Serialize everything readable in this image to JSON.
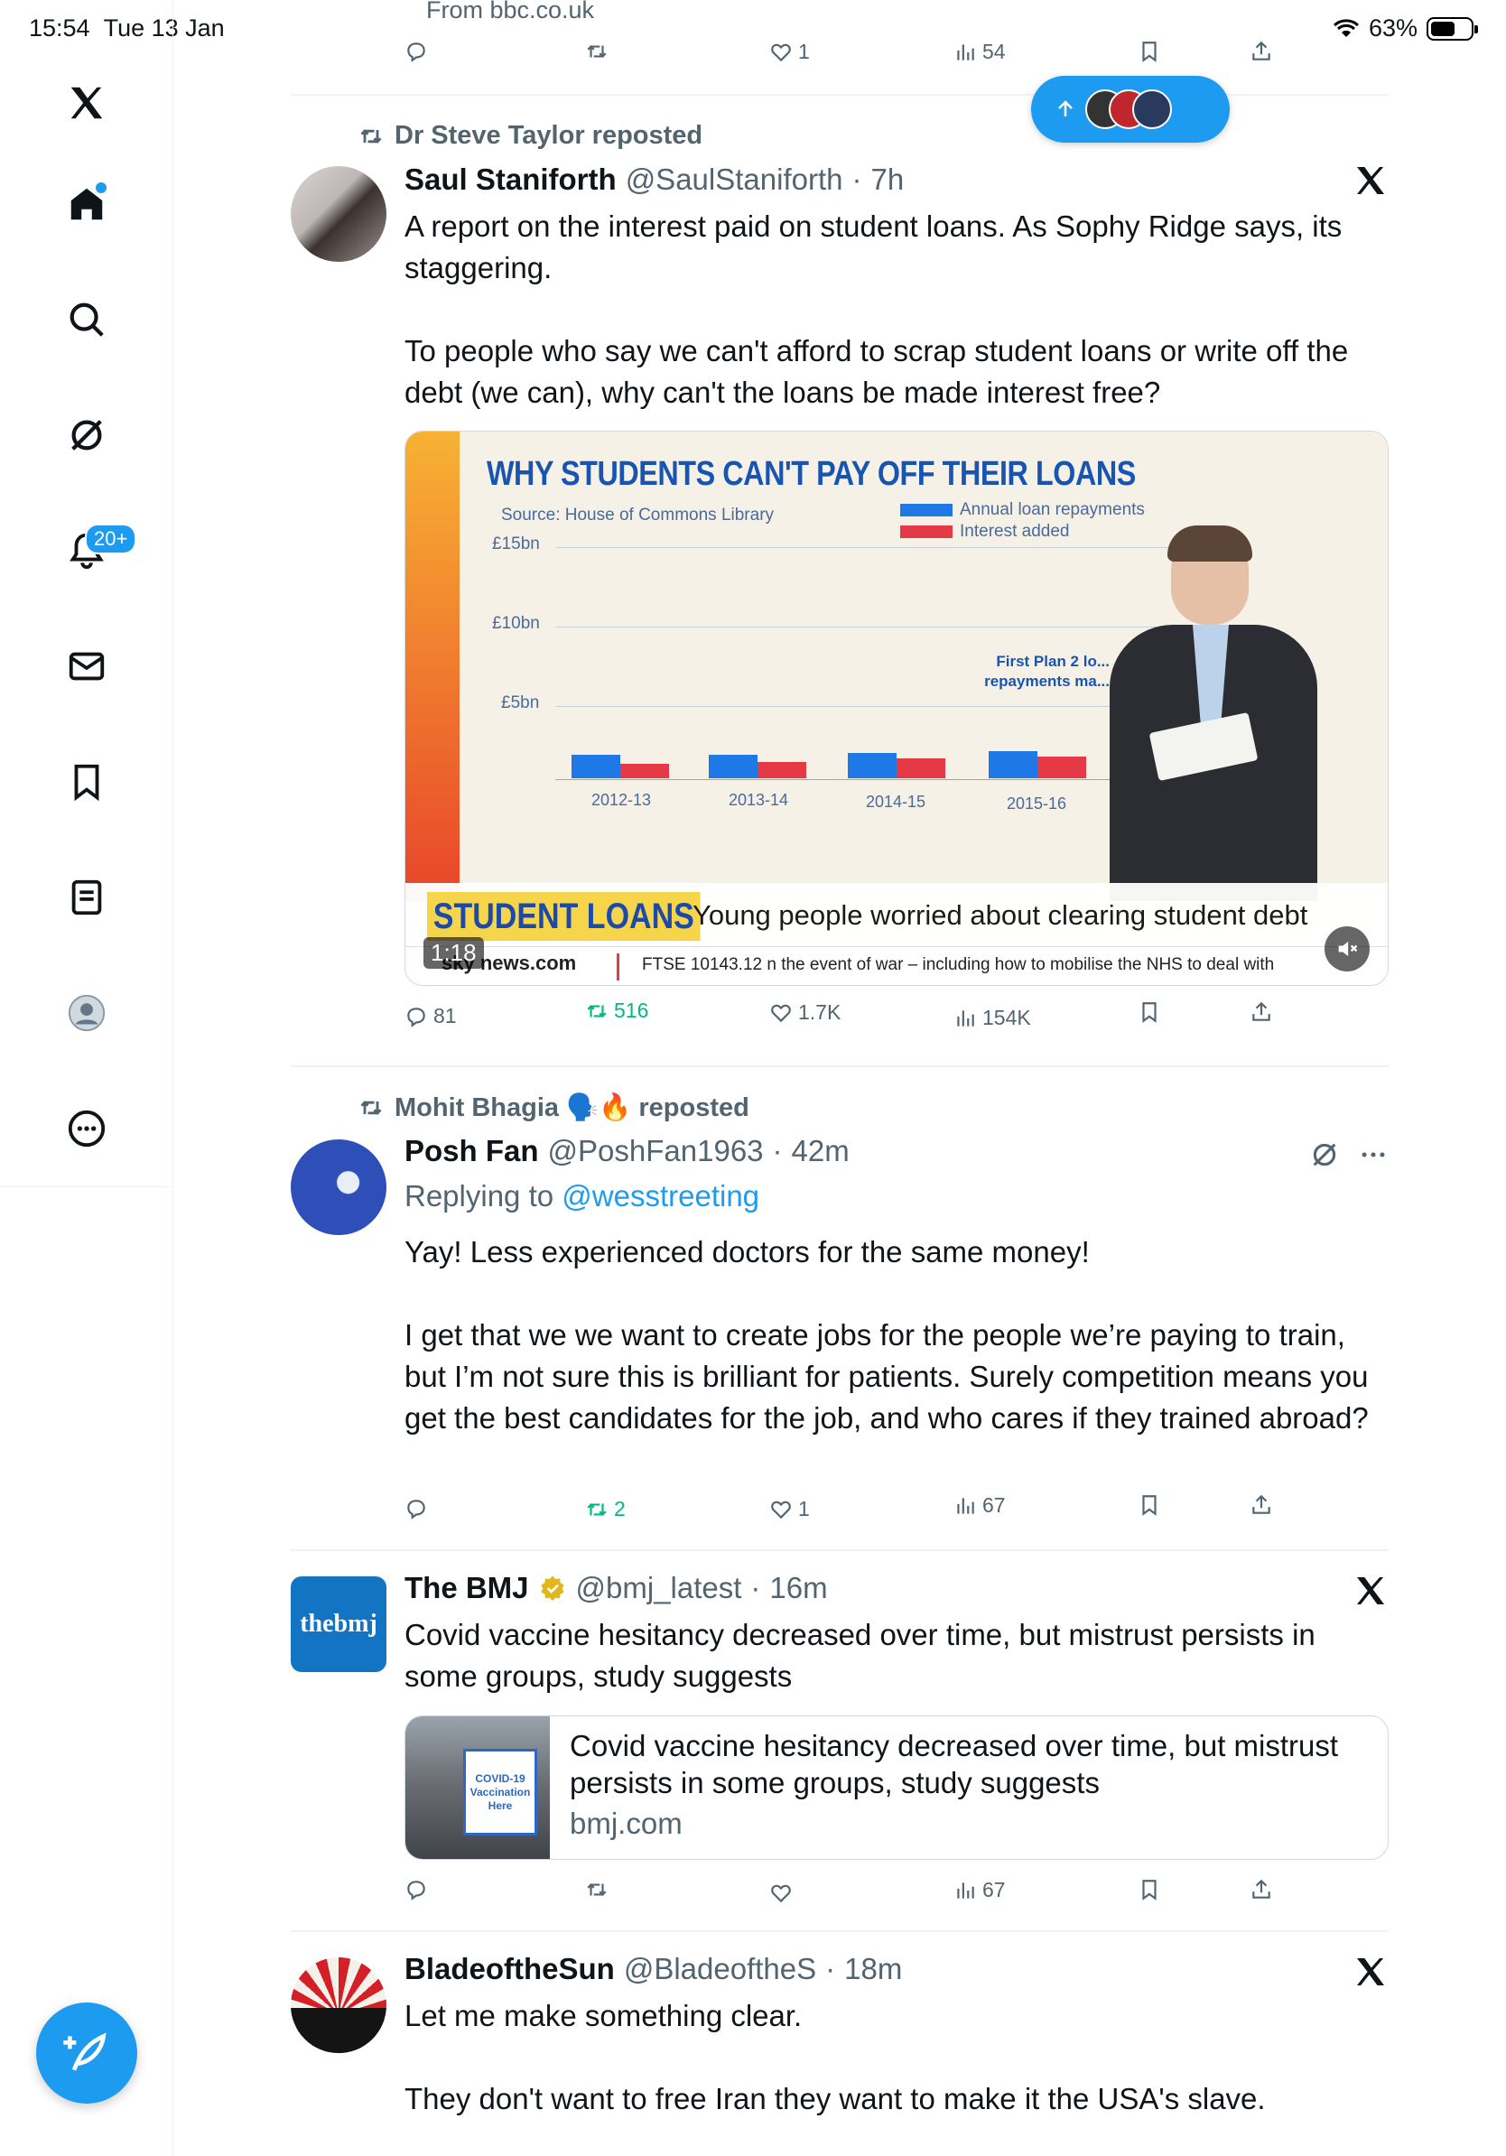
{
  "status": {
    "time": "15:54",
    "date": "Tue 13 Jan",
    "battery": "63%",
    "battery_level": 0.63
  },
  "sidebar": {
    "items": [
      {
        "icon": "x-logo-icon"
      },
      {
        "icon": "home-icon",
        "has_dot": true
      },
      {
        "icon": "search-icon"
      },
      {
        "icon": "grok-icon"
      },
      {
        "icon": "notifications-icon",
        "badge": "20+"
      },
      {
        "icon": "messages-icon"
      },
      {
        "icon": "bookmarks-icon"
      },
      {
        "icon": "lists-icon"
      },
      {
        "icon": "profile-icon"
      },
      {
        "icon": "more-icon"
      }
    ],
    "compose_icon": "compose-icon"
  },
  "top_partial": {
    "from_text": "From bbc.co.uk",
    "likes": "1",
    "views": "54"
  },
  "new_posts_pill": {
    "icon": "arrow-up-icon"
  },
  "posts": [
    {
      "repost_by": "Dr Steve Taylor reposted",
      "name": "Saul Staniforth",
      "handle": "@SaulStaniforth",
      "time": "7h",
      "body_1": "A report on the interest paid on student loans. As Sophy Ridge says, its staggering.",
      "body_2": "To people who say we can't afford to scrap student loans or write off the debt (we can), why can't the loans be made interest free?",
      "media": {
        "chart_title": "WHY STUDENTS CAN'T PAY OFF THEIR LOANS",
        "source": "Source: House of Commons Library",
        "legend_1": "Annual loan repayments",
        "legend_2": "Interest added",
        "y_ticks": [
          "£15bn",
          "£10bn",
          "£5bn"
        ],
        "x_ticks": [
          "2012-13",
          "2013-14",
          "2014-15",
          "2015-16"
        ],
        "annotation": "First Plan 2 lo... repayments ma...",
        "banner_title": "STUDENT LOANS",
        "banner_text": "Young people worried about clearing student debt",
        "ticker_brand": "sky news.com",
        "ticker_text": "FTSE 10143.12   n the event of war – including how to mobilise the NHS to deal with",
        "duration": "1:18"
      },
      "replies": "81",
      "reposts": "516",
      "likes": "1.7K",
      "views": "154K"
    },
    {
      "repost_by": "Mohit Bhagia 🗣️🔥 reposted",
      "name": "Posh Fan",
      "handle": "@PoshFan1963",
      "time": "42m",
      "replying_prefix": "Replying to",
      "replying_to": "@wesstreeting",
      "body_1": "Yay! Less experienced doctors for the same money!",
      "body_2": "I get that we we want to create jobs for the people we’re paying to train, but I’m not sure this is brilliant for patients. Surely competition means you get the best candidates for the job, and who cares if they trained abroad?",
      "reposts": "2",
      "likes": "1",
      "views": "67"
    },
    {
      "name": "The BMJ",
      "handle": "@bmj_latest",
      "time": "16m",
      "avatar_text": "thebmj",
      "body_1": "Covid vaccine hesitancy decreased over time, but mistrust persists in some groups, study suggests",
      "card_title": "Covid vaccine hesitancy decreased over time, but mistrust persists in some groups, study suggests",
      "card_domain": "bmj.com",
      "card_image_text": "COVID-19 Vaccination Here",
      "views": "67"
    },
    {
      "name": "BladeoftheSun",
      "handle": "@BladeoftheS",
      "time": "18m",
      "body_1": "Let me make something clear.",
      "body_2": "They don't want to free Iran they want to make it the USA's slave."
    }
  ]
}
